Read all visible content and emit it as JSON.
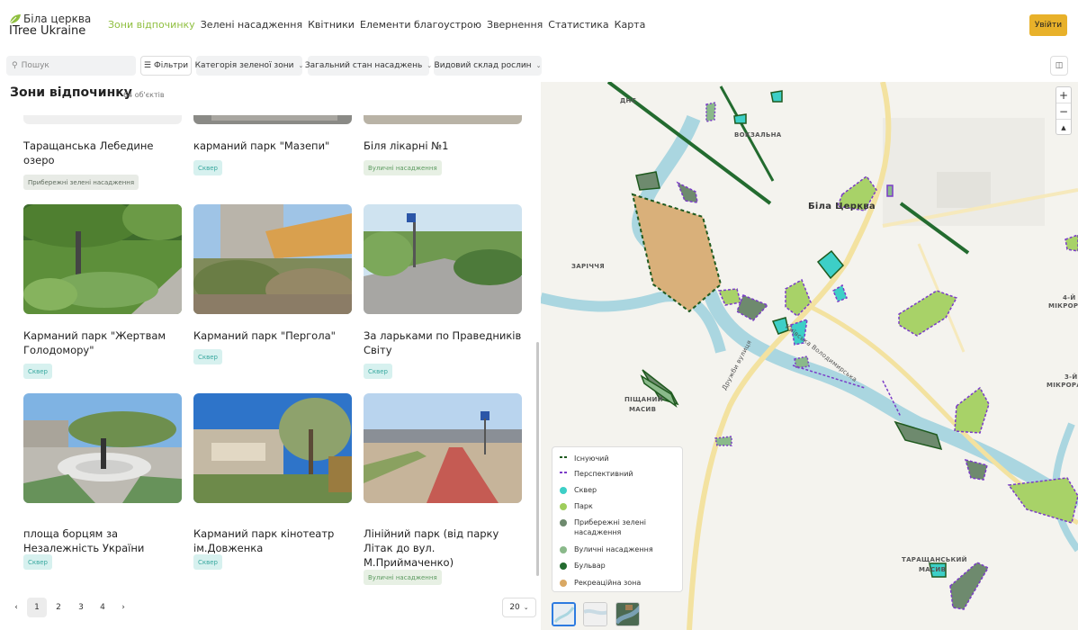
{
  "brand": {
    "line1": "Біла церква",
    "line2": "ITree Ukraine"
  },
  "nav": [
    "Зони відпочинку",
    "Зелені насадження",
    "Квітники",
    "Елементи благоустрою",
    "Звернення",
    "Статистика",
    "Карта"
  ],
  "nav_active": 0,
  "login_label": "Увійти",
  "search": {
    "placeholder": "Пошук"
  },
  "filters_label": "Фільтри",
  "dropdowns": [
    "Категорія зеленої зони",
    "Загальний стан насаджень",
    "Видовий склад рослин"
  ],
  "page": {
    "title": "Зони відпочинку",
    "count": "64 об'єктів"
  },
  "cards": [
    {
      "title": "Таращанська Лебедине озеро",
      "badge": "Прибережні зелені насадження",
      "kind": "pryb"
    },
    {
      "title": "карманий парк \"Мазепи\"",
      "badge": "Сквер",
      "kind": "skver"
    },
    {
      "title": "Біля лікарні №1",
      "badge": "Вуличні насадження",
      "kind": "vul"
    },
    {
      "title": "Карманий парк \"Жертвам Голодомору\"",
      "badge": "Сквер",
      "kind": "skver"
    },
    {
      "title": "Карманий парк \"Пергола\"",
      "badge": "Сквер",
      "kind": "skver"
    },
    {
      "title": "За ларьками по Праведників Світу",
      "badge": "Сквер",
      "kind": "skver"
    },
    {
      "title": "площа борцям за Незалежність України",
      "badge": "Сквер",
      "kind": "skver"
    },
    {
      "title": "Карманий парк кінотеатр ім.Довженка",
      "badge": "Сквер",
      "kind": "skver"
    },
    {
      "title": "Лінійний парк (від парку Літак до вул. М.Приймаченко)",
      "badge": "Вуличні насадження",
      "kind": "vul"
    }
  ],
  "pagination": {
    "pages": [
      "1",
      "2",
      "3",
      "4"
    ],
    "current": "1",
    "prev": "‹",
    "next": "›",
    "per_page": "20"
  },
  "map": {
    "labels": [
      {
        "text": "ДНС",
        "kind": "small"
      },
      {
        "text": "ВОКЗАЛЬНА",
        "kind": "small"
      },
      {
        "text": "Біла Церква",
        "kind": "big"
      },
      {
        "text": "ЗАРІЧЧЯ",
        "kind": "small"
      },
      {
        "text": "ПІЩАНИЙ",
        "kind": "small"
      },
      {
        "text": "МАСИВ",
        "kind": "small"
      },
      {
        "text": "4-Й",
        "kind": "small"
      },
      {
        "text": "МІКРОРА",
        "kind": "small"
      },
      {
        "text": "3-Й",
        "kind": "small"
      },
      {
        "text": "МІКРОРАЙО",
        "kind": "small"
      },
      {
        "text": "ТАРАЩАНСЬКИЙ",
        "kind": "small"
      },
      {
        "text": "МАСИВ",
        "kind": "small"
      },
      {
        "text": "Дружби вулиця",
        "kind": "street"
      },
      {
        "text": "Київська Володимирська",
        "kind": "street"
      }
    ],
    "zoom_in": "+",
    "zoom_out": "−",
    "compass": "▲"
  },
  "legend": [
    {
      "label": "Існуючий",
      "type": "line",
      "color": "#1f5a1f"
    },
    {
      "label": "Перспективний",
      "type": "line",
      "color": "#7b3cc8"
    },
    {
      "label": "Сквер",
      "type": "dot",
      "color": "#3dcfc7"
    },
    {
      "label": "Парк",
      "type": "dot",
      "color": "#9fcd5c"
    },
    {
      "label": "Прибережні зелені насадження",
      "type": "dot",
      "color": "#6e8a6e"
    },
    {
      "label": "Вуличні насадження",
      "type": "dot",
      "color": "#8ab98a"
    },
    {
      "label": "Бульвар",
      "type": "dot",
      "color": "#236b2f"
    },
    {
      "label": "Рекреаційна зона",
      "type": "dot",
      "color": "#d9a863"
    }
  ],
  "legend_split": [
    "Прибережні зелені",
    "насадження"
  ]
}
